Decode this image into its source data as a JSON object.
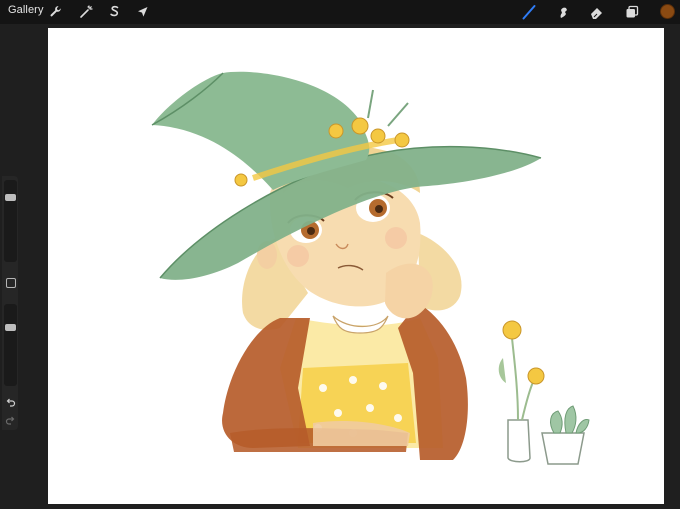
{
  "app": {
    "gallery_label": "Gallery"
  },
  "toolbar": {
    "left_tools": [
      {
        "name": "actions",
        "icon": "wrench-icon"
      },
      {
        "name": "adjustments",
        "icon": "magic-wand-icon"
      },
      {
        "name": "selection",
        "icon": "selection-s-icon"
      },
      {
        "name": "transform",
        "icon": "cursor-arrow-icon"
      }
    ],
    "right_tools": [
      {
        "name": "brush",
        "icon": "brush-icon",
        "active": true
      },
      {
        "name": "smudge",
        "icon": "smudge-icon",
        "active": false
      },
      {
        "name": "eraser",
        "icon": "eraser-icon",
        "active": false
      },
      {
        "name": "layers",
        "icon": "layers-icon",
        "active": false
      }
    ],
    "current_color": "#8a4a12",
    "accent_color": "#2f7cf6"
  },
  "sidebar": {
    "brush_size_level": 0.18,
    "opacity_level": 0.27,
    "modify_button_icon": "square-icon",
    "undo_icon": "undo-arrow-icon",
    "redo_icon": "redo-arrow-icon"
  },
  "canvas": {
    "background": "#ffffff",
    "artwork": "witch-girl-illustration"
  }
}
